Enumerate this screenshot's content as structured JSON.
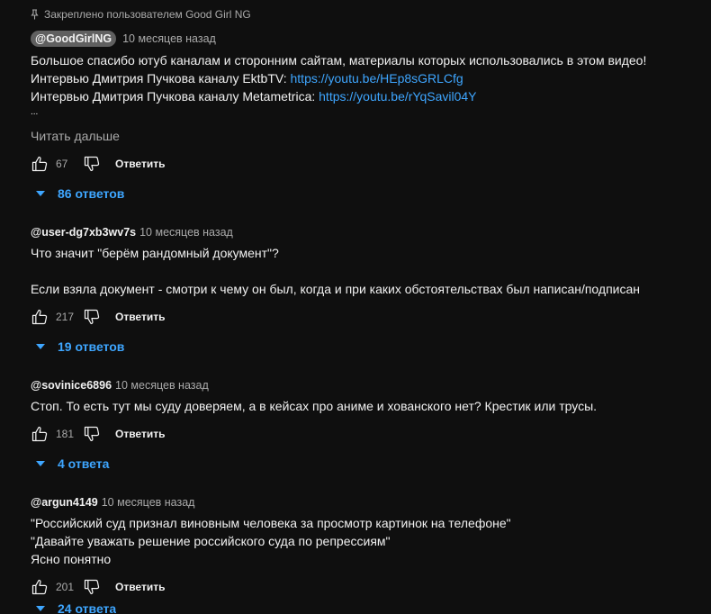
{
  "pinned": {
    "text": "Закреплено пользователем Good Girl NG"
  },
  "comments": [
    {
      "author": "@GoodGirlNG",
      "time": "10 месяцев назад",
      "lines": [
        "Большое спасибо ютуб каналам и сторонним сайтам, материалы которых использовались в этом видео!",
        {
          "prefix": "Интервью Дмитрия Пучкова каналу EktbTV: ",
          "link": "https://youtu.be/HEp8sGRLCfg"
        },
        {
          "prefix": "Интервью Дмитрия Пучкова каналу Metametrica: ",
          "link": "https://youtu.be/rYqSavil04Y"
        },
        "..."
      ],
      "read_more": "Читать дальше",
      "likes": "67",
      "reply_label": "Ответить",
      "replies": "86 ответов"
    },
    {
      "author": "@user-dg7xb3wv7s",
      "time": "10 месяцев назад",
      "lines": [
        "Что значит \"берём рандомный документ\"?",
        "",
        "Если взяла документ - смотри к чему он был, когда и при каких обстоятельствах был написан/подписан"
      ],
      "likes": "217",
      "reply_label": "Ответить",
      "replies": "19 ответов"
    },
    {
      "author": "@sovinice6896",
      "time": "10 месяцев назад",
      "lines": [
        "Стоп. То есть тут мы суду доверяем, а в кейсах про аниме и хованского нет? Крестик или трусы."
      ],
      "likes": "181",
      "reply_label": "Ответить",
      "replies": "4 ответа"
    },
    {
      "author": "@argun4149",
      "time": "10 месяцев назад",
      "lines": [
        "\"Российский суд признал виновным человека за просмотр картинок на телефоне\"",
        "\"Давайте уважать решение российского суда по репрессиям\"",
        "Ясно понятно"
      ],
      "likes": "201",
      "reply_label": "Ответить",
      "replies": "24 ответа"
    }
  ],
  "colors": {
    "background": "#0f0f0f",
    "text": "#f1f1f1",
    "muted": "#aaaaaa",
    "link": "#3ea6ff",
    "chip": "#606060"
  }
}
